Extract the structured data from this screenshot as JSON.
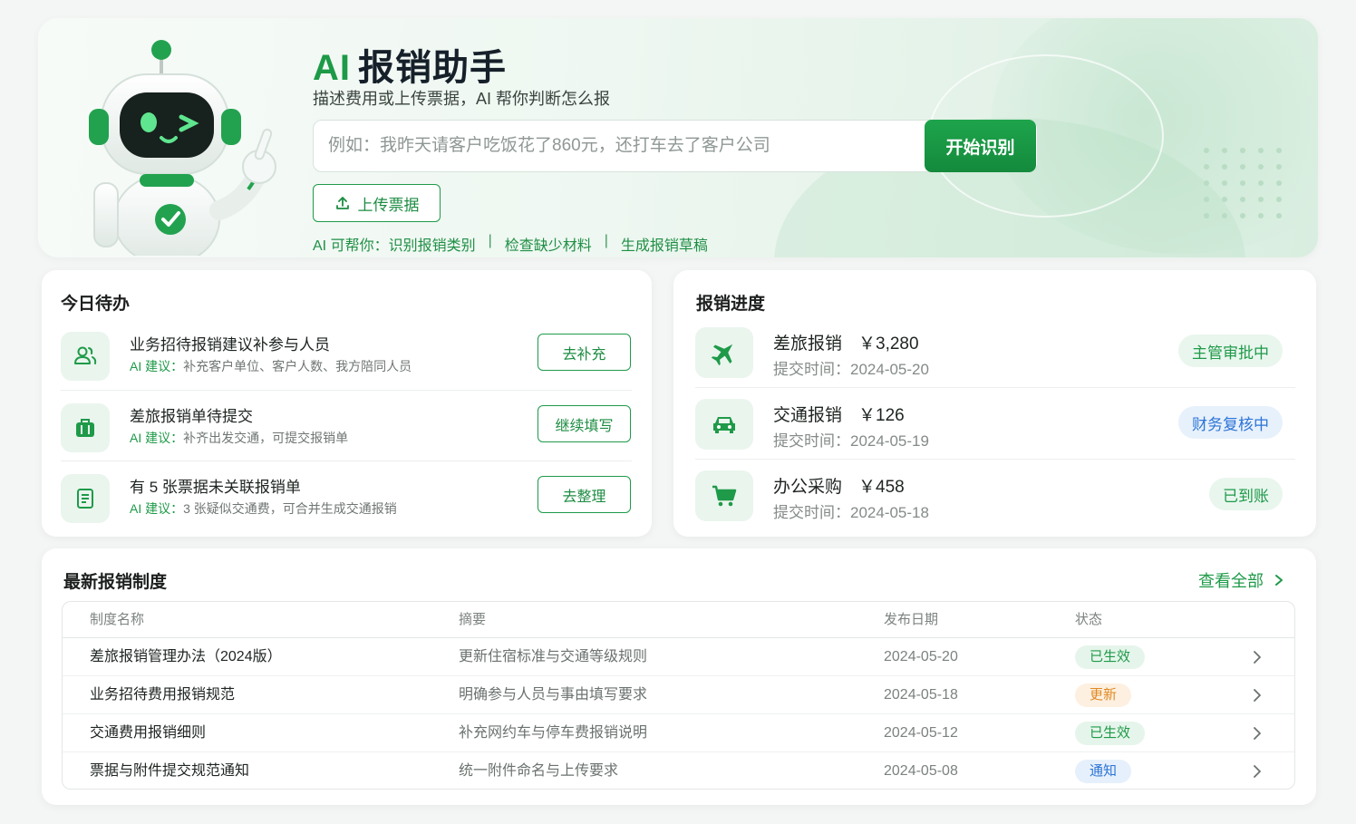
{
  "hero": {
    "title_ai": "AI",
    "title_rest": "报销助手",
    "subtitle": "描述费用或上传票据，AI 帮你判断怎么报",
    "search_placeholder": "例如：我昨天请客户吃饭花了860元，还打车去了客户公司",
    "start_label": "开始识别",
    "upload_label": "上传票据",
    "help_prefix": "AI 可帮你：",
    "help_items": [
      "识别报销类别",
      "检查缺少材料",
      "生成报销草稿"
    ],
    "help_sep": "|"
  },
  "todo": {
    "title": "今日待办",
    "items": [
      {
        "icon": "users-icon",
        "title": "业务招待报销建议补参与人员",
        "suggest_label": "AI 建议：",
        "suggest_text": "补充客户单位、客户人数、我方陪同人员",
        "action": "去补充"
      },
      {
        "icon": "suitcase-icon",
        "title": "差旅报销单待提交",
        "suggest_label": "AI 建议：",
        "suggest_text": "补齐出发交通，可提交报销单",
        "action": "继续填写"
      },
      {
        "icon": "receipt-icon",
        "title": "有 5 张票据未关联报销单",
        "suggest_label": "AI 建议：",
        "suggest_text": "3 张疑似交通费，可合并生成交通报销",
        "action": "去整理"
      }
    ]
  },
  "progress": {
    "title": "报销进度",
    "items": [
      {
        "icon": "airplane-icon",
        "name": "差旅报销",
        "amount": "￥3,280",
        "time_label": "提交时间：",
        "time": "2024-05-20",
        "status": "主管审批中",
        "status_color": "green"
      },
      {
        "icon": "car-icon",
        "name": "交通报销",
        "amount": "￥126",
        "time_label": "提交时间：",
        "time": "2024-05-19",
        "status": "财务复核中",
        "status_color": "blue"
      },
      {
        "icon": "cart-icon",
        "name": "办公采购",
        "amount": "￥458",
        "time_label": "提交时间：",
        "time": "2024-05-18",
        "status": "已到账",
        "status_color": "green"
      }
    ]
  },
  "policy": {
    "title": "最新报销制度",
    "view_all": "查看全部",
    "columns": [
      "制度名称",
      "摘要",
      "发布日期",
      "状态"
    ],
    "rows": [
      {
        "name": "差旅报销管理办法（2024版）",
        "summary": "更新住宿标准与交通等级规则",
        "date": "2024-05-20",
        "status": "已生效",
        "status_color": "green"
      },
      {
        "name": "业务招待费用报销规范",
        "summary": "明确参与人员与事由填写要求",
        "date": "2024-05-18",
        "status": "更新",
        "status_color": "orange"
      },
      {
        "name": "交通费用报销细则",
        "summary": "补充网约车与停车费报销说明",
        "date": "2024-05-12",
        "status": "已生效",
        "status_color": "green"
      },
      {
        "name": "票据与附件提交规范通知",
        "summary": "统一附件命名与上传要求",
        "date": "2024-05-08",
        "status": "通知",
        "status_color": "blue"
      }
    ]
  },
  "colors": {
    "brand": "#1f9a49",
    "brand_bg": "#eaf5ee",
    "blue": "#2c74d6",
    "orange": "#e08a24"
  }
}
